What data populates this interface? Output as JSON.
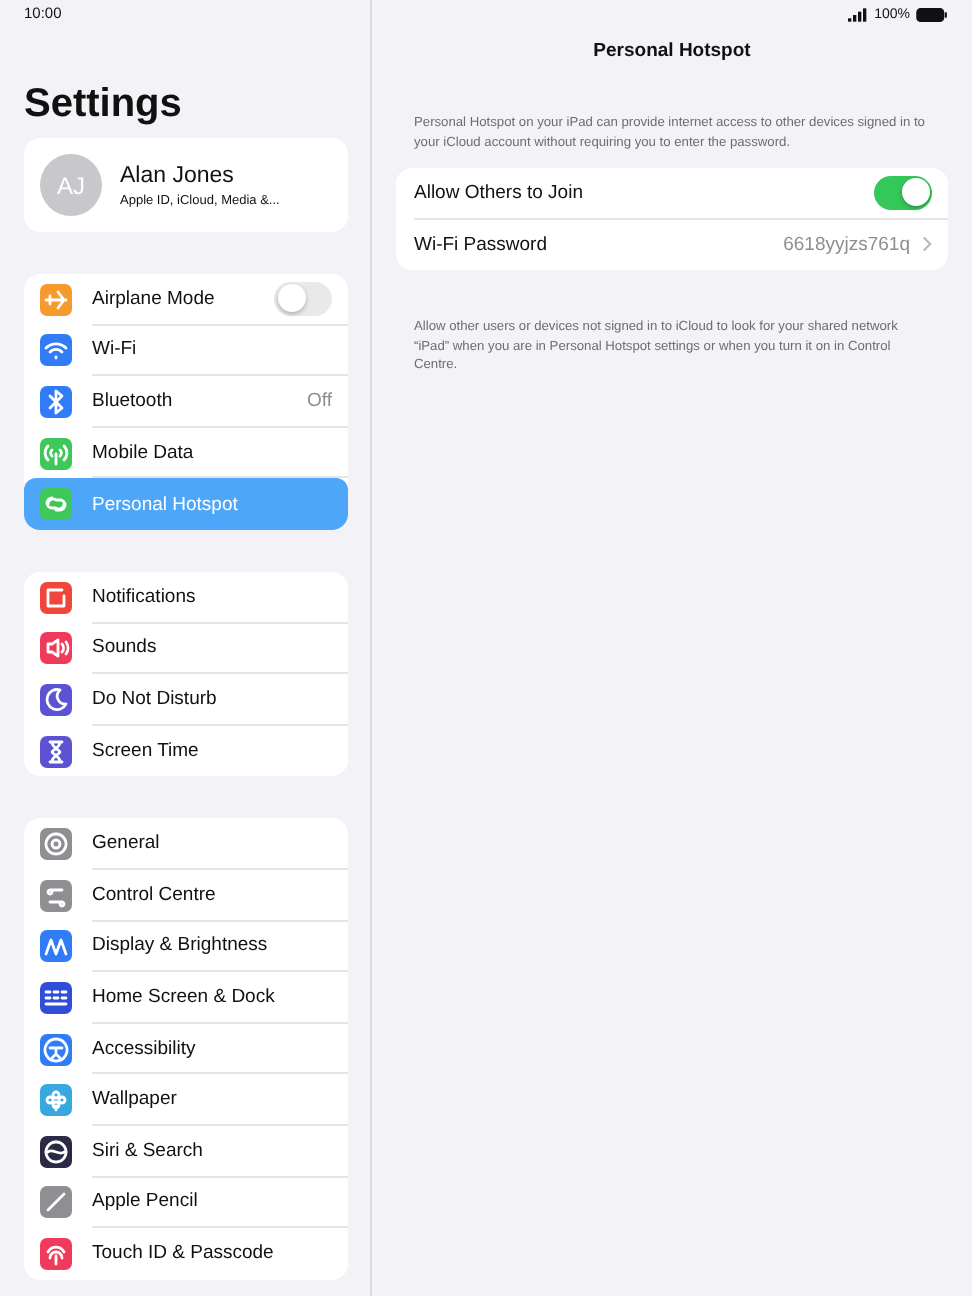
{
  "status_bar": {
    "time": "10:00",
    "battery": "100%"
  },
  "sidebar": {
    "title": "Settings",
    "profile": {
      "initials": "AJ",
      "name": "Alan Jones",
      "subtitle": "Apple ID, iCloud, Media &..."
    },
    "groups": [
      {
        "items": [
          {
            "label": "Airplane Mode",
            "kind": "toggle",
            "on": false,
            "color": "#f79a2e",
            "selected": false
          },
          {
            "label": "Wi-Fi",
            "kind": "plain",
            "color": "#2f7cf6",
            "selected": false
          },
          {
            "label": "Bluetooth",
            "kind": "value",
            "value": "Off",
            "color": "#2f7cf6",
            "selected": false
          },
          {
            "label": "Mobile Data",
            "kind": "plain",
            "color": "#3ec85a",
            "selected": false
          },
          {
            "label": "Personal Hotspot",
            "kind": "plain",
            "color": "#3ec85a",
            "selected": true
          }
        ]
      },
      {
        "items": [
          {
            "label": "Notifications",
            "kind": "plain",
            "color": "#f0463c",
            "selected": false
          },
          {
            "label": "Sounds",
            "kind": "plain",
            "color": "#f03a5c",
            "selected": false
          },
          {
            "label": "Do Not Disturb",
            "kind": "plain",
            "color": "#5b53d4",
            "selected": false
          },
          {
            "label": "Screen Time",
            "kind": "plain",
            "color": "#5b53d4",
            "selected": false
          }
        ]
      },
      {
        "items": [
          {
            "label": "General",
            "kind": "plain",
            "color": "#8e8e93",
            "selected": false
          },
          {
            "label": "Control Centre",
            "kind": "plain",
            "color": "#8e8e93",
            "selected": false
          },
          {
            "label": "Display & Brightness",
            "kind": "plain",
            "color": "#2f7cf6",
            "selected": false
          },
          {
            "label": "Home Screen & Dock",
            "kind": "plain",
            "color": "#2f4fd6",
            "selected": false
          },
          {
            "label": "Accessibility",
            "kind": "plain",
            "color": "#2f7cf6",
            "selected": false
          },
          {
            "label": "Wallpaper",
            "kind": "plain",
            "color": "#38a8e0",
            "selected": false
          },
          {
            "label": "Siri & Search",
            "kind": "plain",
            "color": "#2a2a44",
            "selected": false
          },
          {
            "label": "Apple Pencil",
            "kind": "plain",
            "color": "#8e8e93",
            "selected": false
          },
          {
            "label": "Touch ID & Passcode",
            "kind": "plain",
            "color": "#f03a5c",
            "selected": false
          }
        ]
      }
    ]
  },
  "detail": {
    "title": "Personal Hotspot",
    "description": "Personal Hotspot on your iPad can provide internet access to other devices signed in to your iCloud account without requiring you to enter the password.",
    "rows": [
      {
        "label": "Allow Others to Join",
        "kind": "toggle",
        "on": true
      },
      {
        "label": "Wi-Fi Password",
        "kind": "disclosure",
        "value": "6618yyjzs761q"
      }
    ],
    "footer": "Allow other users or devices not signed in to iCloud to look for your shared network “iPad” when you are in Personal Hotspot settings or when you turn it on in Control Centre."
  }
}
